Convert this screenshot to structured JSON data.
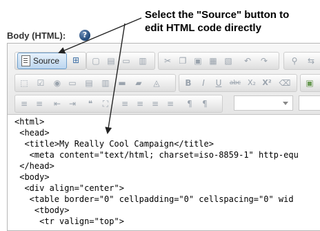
{
  "annotation": {
    "line1": "Select the \"Source\" button to",
    "line2": "edit HTML code directly"
  },
  "field": {
    "label": "Body (HTML):",
    "help_icon": "?"
  },
  "toolbar": {
    "source_label": "Source",
    "row1_icons": [
      "preview-icon",
      "new-page-icon",
      "template-icon",
      "print-icon",
      "cut-icon",
      "copy-icon",
      "paste-icon",
      "paste-text-icon",
      "paste-word-icon",
      "undo-icon",
      "redo-icon",
      "find-icon",
      "replace-icon"
    ],
    "row2_icons": [
      "form-icon",
      "checkbox-icon",
      "radio-icon",
      "textfield-icon",
      "textarea-icon",
      "select-icon",
      "button-icon",
      "image-button-icon",
      "hidden-field-icon"
    ],
    "row2_glyphs": [
      "B",
      "I",
      "U",
      "abc",
      "X₂",
      "X²"
    ],
    "row3_glyphs": [
      "≡",
      "≡",
      "⇤",
      "⇥",
      "❝",
      "⛶",
      "≡",
      "≡",
      "≡",
      "≡",
      "¶",
      "¶"
    ]
  },
  "code": {
    "lines": [
      "<html>",
      " <head>",
      "  <title>My Really Cool Campaign</title>",
      "   <meta content=\"text/html; charset=iso-8859-1\" http-equ",
      " </head>",
      " <body>",
      "  <div align=\"center\">",
      "   <table border=\"0\" cellpadding=\"0\" cellspacing=\"0\" wid",
      "    <tbody>",
      "     <tr valign=\"top\">"
    ]
  }
}
